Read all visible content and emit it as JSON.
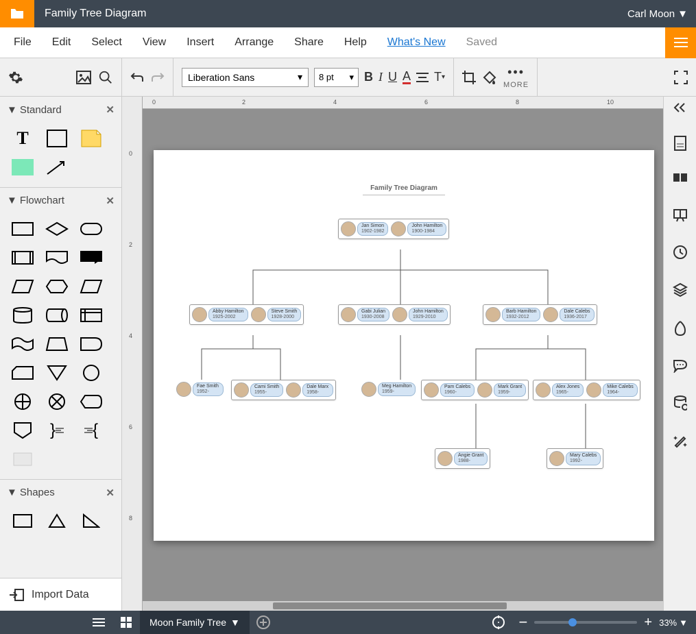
{
  "titlebar": {
    "title": "Family Tree Diagram",
    "user": "Carl Moon"
  },
  "menubar": {
    "items": [
      "File",
      "Edit",
      "Select",
      "View",
      "Insert",
      "Arrange",
      "Share",
      "Help"
    ],
    "whatsnew": "What's New",
    "saved": "Saved"
  },
  "toolbar": {
    "font": "Liberation Sans",
    "fontsize": "8 pt",
    "more": "MORE"
  },
  "leftpanel": {
    "sections": [
      {
        "title": "Standard"
      },
      {
        "title": "Flowchart"
      },
      {
        "title": "Shapes"
      }
    ],
    "import": "Import Data"
  },
  "diagram": {
    "title": "Family Tree Diagram",
    "people": {
      "gen1a": {
        "name": "Jan Simon",
        "dates": "1902-1982"
      },
      "gen1b": {
        "name": "John Hamilton",
        "dates": "1900-1984"
      },
      "gen2a1": {
        "name": "Abby Hamilton",
        "dates": "1925-2002"
      },
      "gen2a2": {
        "name": "Steve Smith",
        "dates": "1928-2000"
      },
      "gen2b1": {
        "name": "Gabi Julian",
        "dates": "1930-2008"
      },
      "gen2b2": {
        "name": "John Hamilton",
        "dates": "1929-2010"
      },
      "gen2c1": {
        "name": "Barb Hamilton",
        "dates": "1932-2012"
      },
      "gen2c2": {
        "name": "Dale Calebs",
        "dates": "1936-2017"
      },
      "gen3a": {
        "name": "Fae Smith",
        "dates": "1952-"
      },
      "gen3b": {
        "name": "Cami Smith",
        "dates": "1955-"
      },
      "gen3c": {
        "name": "Dale Marx",
        "dates": "1958-"
      },
      "gen3d": {
        "name": "Meg Hamilton",
        "dates": "1959-"
      },
      "gen3e1": {
        "name": "Pam Calebs",
        "dates": "1960-"
      },
      "gen3e2": {
        "name": "Mark Grant",
        "dates": "1959-"
      },
      "gen3f1": {
        "name": "Alex Jones",
        "dates": "1965-"
      },
      "gen3f2": {
        "name": "Mike Calebs",
        "dates": "1964-"
      },
      "gen4a": {
        "name": "Angie Grant",
        "dates": "1988-"
      },
      "gen4b": {
        "name": "Mary Calebs",
        "dates": "1992-"
      }
    }
  },
  "bottombar": {
    "tab": "Moon Family Tree",
    "zoom": "33%"
  },
  "ruler": {
    "top": [
      "0",
      "2",
      "4",
      "6",
      "8",
      "10"
    ],
    "left": [
      "0",
      "2",
      "4",
      "6",
      "8"
    ]
  }
}
